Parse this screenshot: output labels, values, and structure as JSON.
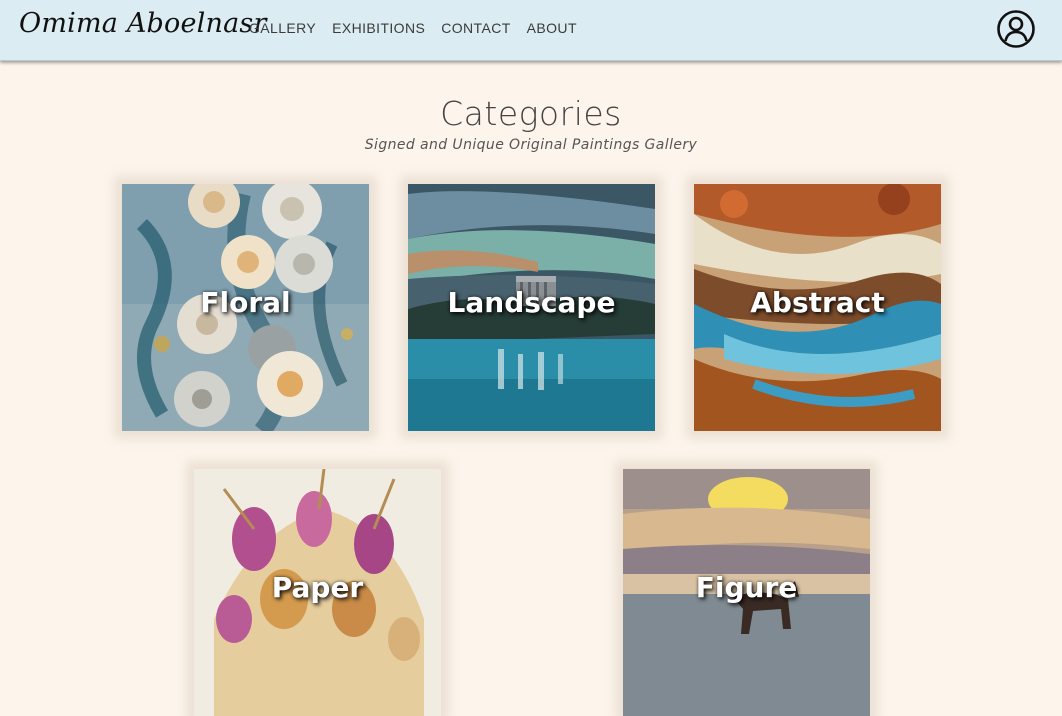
{
  "brand": "Omima Aboelnasr",
  "nav": {
    "gallery": "GALLERY",
    "exhibitions": "EXHIBITIONS",
    "contact": "CONTACT",
    "about": "ABOUT"
  },
  "account_icon": "user-circle-icon",
  "page": {
    "title": "Categories",
    "subtitle": "Signed and Unique Original Paintings Gallery"
  },
  "categories": [
    {
      "label": "Floral"
    },
    {
      "label": "Landscape"
    },
    {
      "label": "Abstract"
    },
    {
      "label": "Paper"
    },
    {
      "label": "Figure"
    }
  ],
  "colors": {
    "nav_bg": "#dbecf3",
    "page_bg": "#fdf5ec",
    "text": "#444444"
  }
}
